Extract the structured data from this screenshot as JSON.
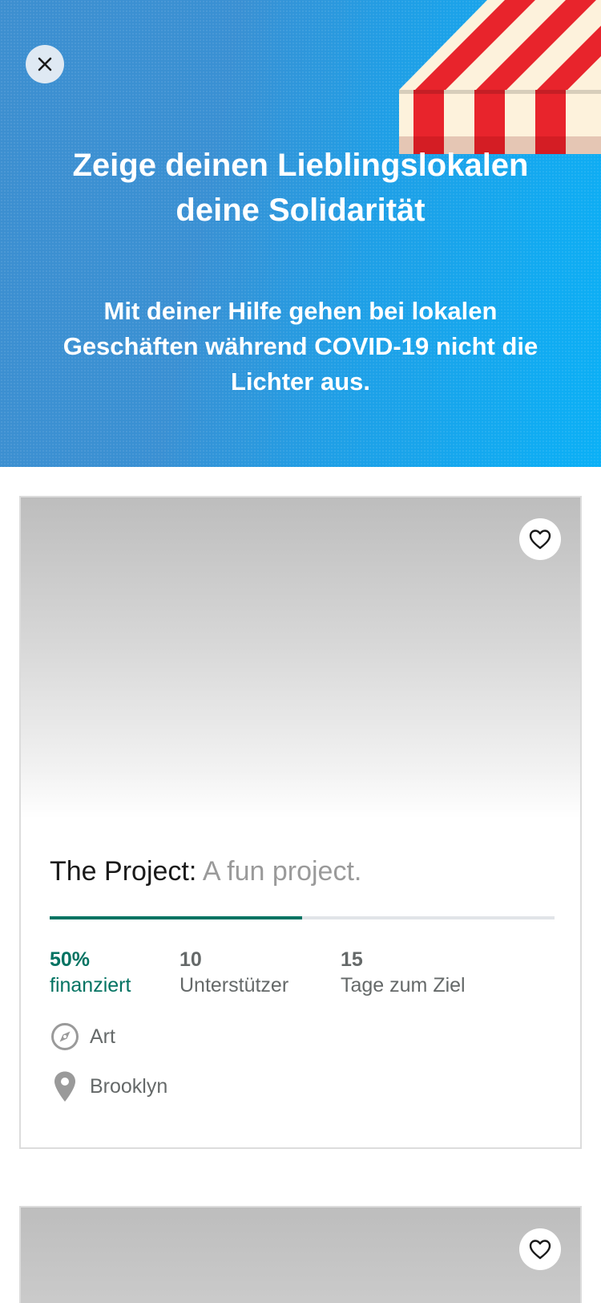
{
  "hero": {
    "title": "Zeige deinen Lieblingslokalen deine Solidarität",
    "subtitle": "Mit deiner Hilfe gehen bei lokalen Geschäften während COVID-19 nicht die Lichter aus.",
    "close_icon": "close-icon"
  },
  "projects": [
    {
      "name": "The Project:",
      "blurb": "A fun project.",
      "funded_percent": 50,
      "funded_value": "50%",
      "funded_label": "finanziert",
      "backers_value": "10",
      "backers_label": "Unterstützer",
      "days_value": "15",
      "days_label": "Tage zum Ziel",
      "category": "Art",
      "location": "Brooklyn",
      "category_icon": "compass-icon",
      "location_icon": "location-pin-icon",
      "save_icon": "heart-icon"
    }
  ],
  "colors": {
    "hero_gradient_start": "#3d8fd0",
    "hero_gradient_end": "#0bb0f6",
    "accent_green": "#037362",
    "awning_red": "#e8242c",
    "awning_cream": "#fdf2dc"
  }
}
